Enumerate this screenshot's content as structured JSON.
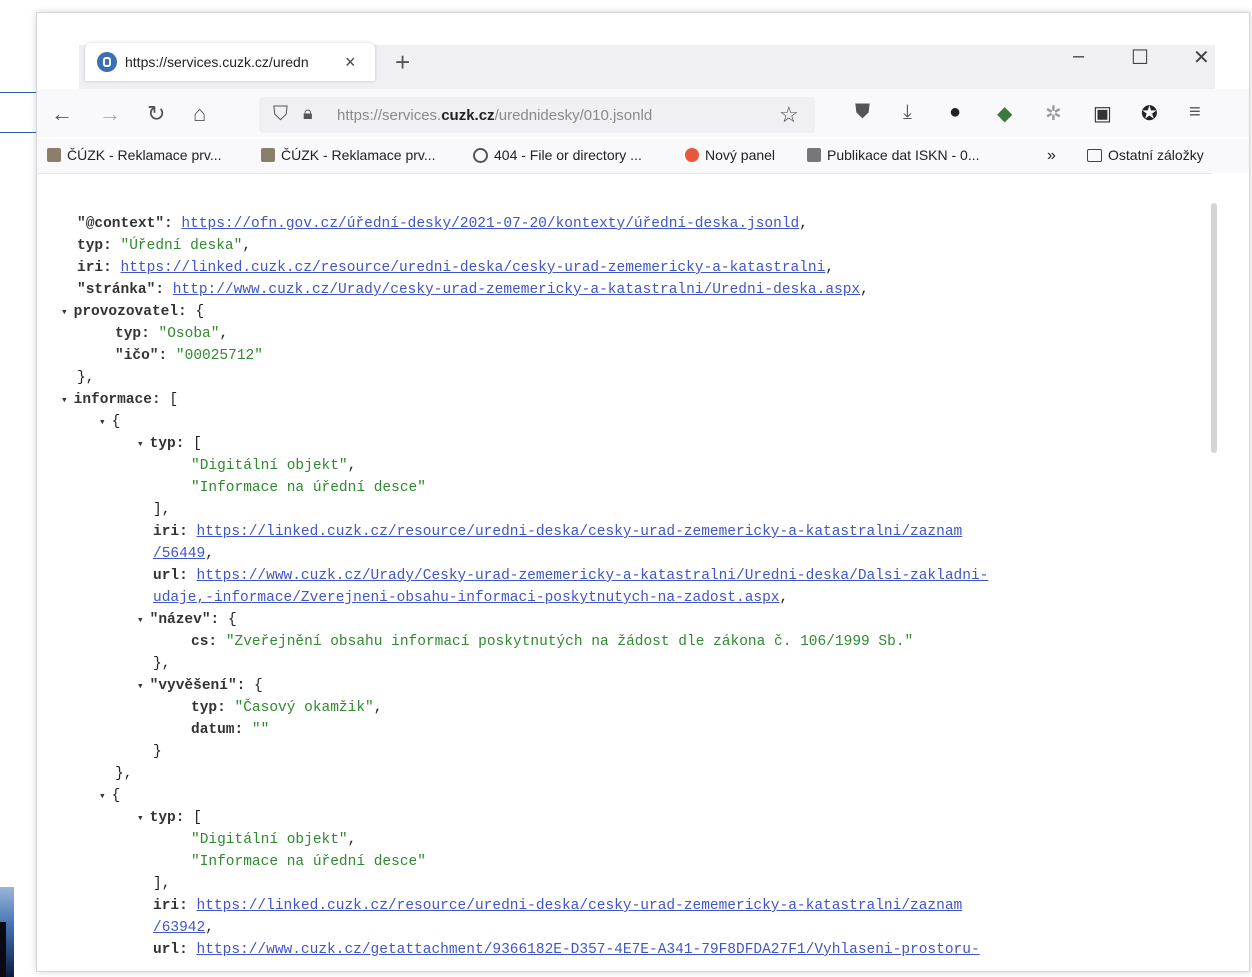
{
  "browser": {
    "tab_title": "https://services.cuzk.cz/uredn",
    "tab_close": "×",
    "new_tab": "+",
    "window_controls": {
      "minimize": "–",
      "maximize": "☐",
      "close": "✕"
    },
    "url_prefix": "https://services.",
    "url_domain": "cuzk.cz",
    "url_path": "/urednidesky/010.jsonld",
    "icons": [
      "back-icon",
      "forward-icon",
      "reload-icon",
      "home-icon",
      "shield-icon",
      "lock-icon",
      "bookmark-star-icon",
      "pocket-icon",
      "download-icon",
      "extension-icon",
      "mascot-icon",
      "gear-icon",
      "screenshot-icon",
      "firefox-icon",
      "menu-icon"
    ]
  },
  "bookmarks": [
    {
      "label": "ČÚZK - Reklamace prv...",
      "color": "#8a7f6a"
    },
    {
      "label": "ČÚZK - Reklamace prv...",
      "color": "#8a7f6a"
    },
    {
      "label": "404 - File or directory ...",
      "color": "#555555"
    },
    {
      "label": "Nový panel",
      "color": "#e8563b"
    },
    {
      "label": "Publikace dat ISKN - 0...",
      "color": "#777777"
    }
  ],
  "bookmarks_more": "»",
  "bookmarks_other": "Ostatní záložky",
  "json": {
    "context_key": "\"@context\":",
    "context_val": "https://ofn.gov.cz/úřední-desky/2021-07-20/kontexty/úřední-deska.jsonld",
    "typ_key": "typ:",
    "typ_val": "\"Úřední deska\"",
    "iri_key": "iri:",
    "iri_val": "https://linked.cuzk.cz/resource/uredni-deska/cesky-urad-zememericky-a-katastralni",
    "stranka_key": "\"stránka\":",
    "stranka_val": "http://www.cuzk.cz/Urady/cesky-urad-zememericky-a-katastralni/Uredni-deska.aspx",
    "provozovatel_key": "provozovatel:",
    "prov_typ_val": "\"Osoba\"",
    "ico_key": "\"ičo\":",
    "ico_val": "\"00025712\"",
    "informace_key": "informace:",
    "item_typ_1": "\"Digitální objekt\"",
    "item_typ_2": "\"Informace na úřední desce\"",
    "item1_iri_a": "https://linked.cuzk.cz/resource/uredni-deska/cesky-urad-zememericky-a-katastralni/zaznam",
    "item1_iri_b": "/56449",
    "url_key": "url:",
    "item1_url_a": "https://www.cuzk.cz/Urady/Cesky-urad-zememericky-a-katastralni/Uredni-deska/Dalsi-zakladni-",
    "item1_url_b": "udaje,-informace/Zverejneni-obsahu-informaci-poskytnutych-na-zadost.aspx",
    "nazev_key": "\"název\":",
    "cs_key": "cs:",
    "cs_val": "\"Zveřejnění obsahu informací poskytnutých na žádost dle zákona č. 106/1999 Sb.\"",
    "vyveseni_key": "\"vyvěšení\":",
    "vyv_typ_val": "\"Časový okamžik\"",
    "datum_key": "datum:",
    "datum_val": "\"\"",
    "item2_iri_a": "https://linked.cuzk.cz/resource/uredni-deska/cesky-urad-zememericky-a-katastralni/zaznam",
    "item2_iri_b": "/63942",
    "item2_url_a": "https://www.cuzk.cz/getattachment/9366182E-D357-4E7E-A341-79F8DFDA27F1/Vyhlaseni-prostoru-"
  }
}
